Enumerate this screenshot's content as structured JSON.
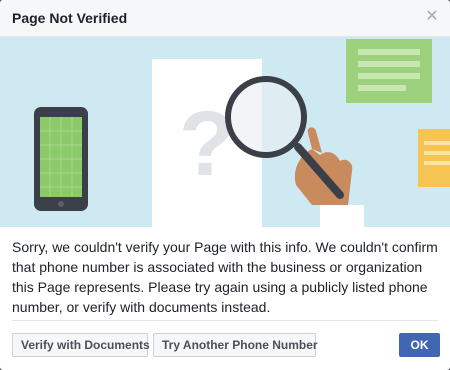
{
  "dialog": {
    "title": "Page Not Verified",
    "close_icon": "close-icon",
    "message": "Sorry, we couldn't verify your Page with this info. We couldn't confirm that phone number is associated with the business or organization this Page represents. Please try again using a publicly listed phone number, or verify with documents instead."
  },
  "illustration": {
    "background_color": "#cfe9f3",
    "document_symbol": "?",
    "icons": [
      "phone-illustration",
      "document-illustration",
      "magnifier-illustration",
      "hand-illustration",
      "note-illustration"
    ]
  },
  "buttons": {
    "verify_docs_label": "Verify with Documents",
    "try_phone_label": "Try Another Phone Number",
    "ok_label": "OK"
  },
  "colors": {
    "primary": "#4267b2",
    "note_green": "#9ed17e",
    "note_yellow": "#f6c453"
  }
}
